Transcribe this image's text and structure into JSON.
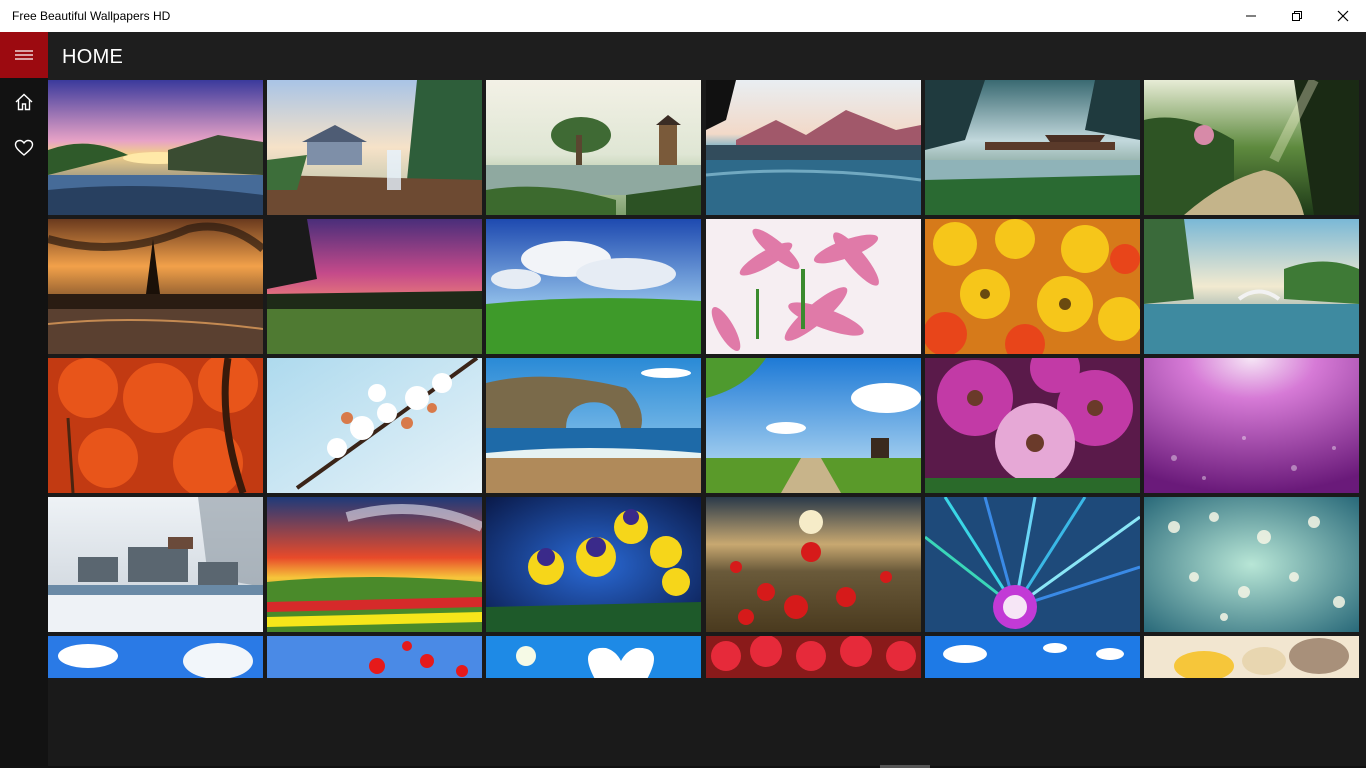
{
  "window": {
    "title": "Free Beautiful Wallpapers HD",
    "controls": [
      "minimize-icon",
      "restore-icon",
      "close-icon"
    ]
  },
  "nav": {
    "accent": "#9c0a10",
    "items": [
      {
        "icon": "home-icon",
        "label": ""
      },
      {
        "icon": "heart-icon",
        "label": ""
      }
    ]
  },
  "header": {
    "title": "HOME"
  },
  "wallpapers": [
    {
      "name": "sunset-lake-village"
    },
    {
      "name": "tropical-resort-waterfall"
    },
    {
      "name": "asian-garden-pagoda"
    },
    {
      "name": "mountain-lake-reflection"
    },
    {
      "name": "misty-bridge-pavilion"
    },
    {
      "name": "forest-path-sunbeams"
    },
    {
      "name": "eiffel-tower-sunset"
    },
    {
      "name": "purple-dusk-meadow"
    },
    {
      "name": "green-hill-blue-sky"
    },
    {
      "name": "pink-daisies"
    },
    {
      "name": "yellow-orange-flowers"
    },
    {
      "name": "park-lake-bridge"
    },
    {
      "name": "red-autumn-trees"
    },
    {
      "name": "cherry-blossom-branch"
    },
    {
      "name": "sea-arch-beach"
    },
    {
      "name": "countryside-windmill-path"
    },
    {
      "name": "purple-gerbera-daisies"
    },
    {
      "name": "purple-light-rays"
    },
    {
      "name": "snowy-rock-garden"
    },
    {
      "name": "flower-field-sunset"
    },
    {
      "name": "yellow-pansies"
    },
    {
      "name": "red-poppy-field"
    },
    {
      "name": "abstract-spiral-rays"
    },
    {
      "name": "teal-floating-petals"
    },
    {
      "name": "blue-sky-clouds"
    },
    {
      "name": "red-poppies-sky"
    },
    {
      "name": "heart-cloud-sky"
    },
    {
      "name": "red-tulips"
    },
    {
      "name": "white-clouds-blue"
    },
    {
      "name": "seashells-sand"
    }
  ]
}
